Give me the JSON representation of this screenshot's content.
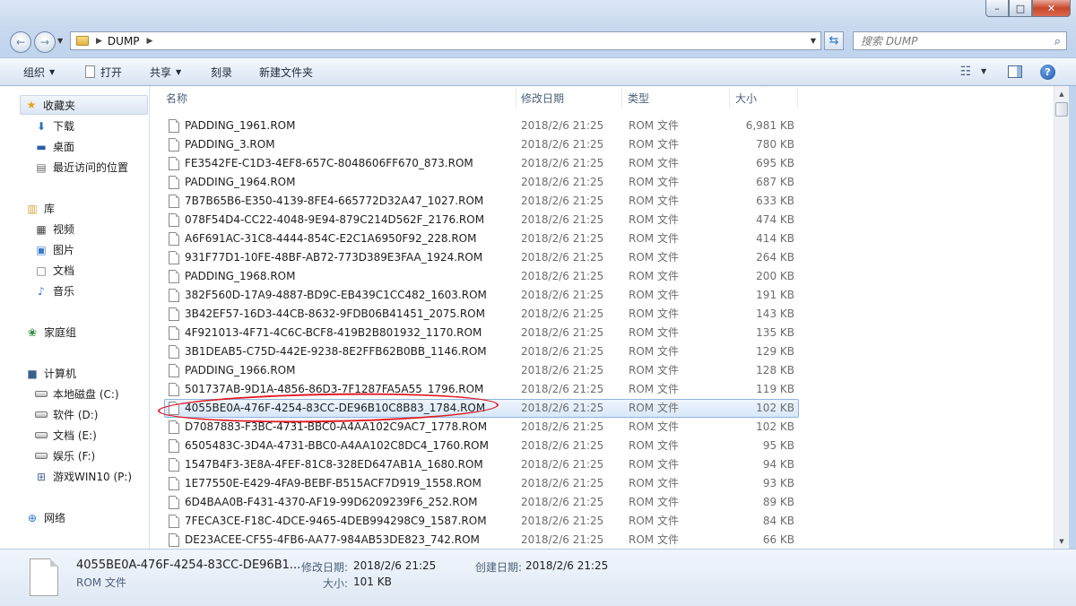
{
  "address": {
    "path": "DUMP"
  },
  "search": {
    "placeholder": "搜索 DUMP"
  },
  "toolbar": {
    "organize": "组织",
    "open": "打开",
    "share": "共享",
    "burn": "刻录",
    "new_folder": "新建文件夹"
  },
  "nav": {
    "favorites": "收藏夹",
    "downloads": "下载",
    "desktop": "桌面",
    "recent": "最近访问的位置",
    "libraries": "库",
    "videos": "视频",
    "pictures": "图片",
    "documents": "文档",
    "music": "音乐",
    "homegroup": "家庭组",
    "computer": "计算机",
    "drives": [
      "本地磁盘 (C:)",
      "软件 (D:)",
      "文档 (E:)",
      "娱乐 (F:)",
      "游戏WIN10 (P:)"
    ],
    "network": "网络"
  },
  "columns": {
    "name": "名称",
    "date": "修改日期",
    "type": "类型",
    "size": "大小"
  },
  "files": [
    {
      "name": "PADDING_1961.ROM",
      "date": "2018/2/6 21:25",
      "type": "ROM 文件",
      "size": "6,981 KB"
    },
    {
      "name": "PADDING_3.ROM",
      "date": "2018/2/6 21:25",
      "type": "ROM 文件",
      "size": "780 KB"
    },
    {
      "name": "FE3542FE-C1D3-4EF8-657C-8048606FF670_873.ROM",
      "date": "2018/2/6 21:25",
      "type": "ROM 文件",
      "size": "695 KB"
    },
    {
      "name": "PADDING_1964.ROM",
      "date": "2018/2/6 21:25",
      "type": "ROM 文件",
      "size": "687 KB"
    },
    {
      "name": "7B7B65B6-E350-4139-8FE4-665772D32A47_1027.ROM",
      "date": "2018/2/6 21:25",
      "type": "ROM 文件",
      "size": "633 KB"
    },
    {
      "name": "078F54D4-CC22-4048-9E94-879C214D562F_2176.ROM",
      "date": "2018/2/6 21:25",
      "type": "ROM 文件",
      "size": "474 KB"
    },
    {
      "name": "A6F691AC-31C8-4444-854C-E2C1A6950F92_228.ROM",
      "date": "2018/2/6 21:25",
      "type": "ROM 文件",
      "size": "414 KB"
    },
    {
      "name": "931F77D1-10FE-48BF-AB72-773D389E3FAA_1924.ROM",
      "date": "2018/2/6 21:25",
      "type": "ROM 文件",
      "size": "264 KB"
    },
    {
      "name": "PADDING_1968.ROM",
      "date": "2018/2/6 21:25",
      "type": "ROM 文件",
      "size": "200 KB"
    },
    {
      "name": "382F560D-17A9-4887-BD9C-EB439C1CC482_1603.ROM",
      "date": "2018/2/6 21:25",
      "type": "ROM 文件",
      "size": "191 KB"
    },
    {
      "name": "3B42EF57-16D3-44CB-8632-9FDB06B41451_2075.ROM",
      "date": "2018/2/6 21:25",
      "type": "ROM 文件",
      "size": "143 KB"
    },
    {
      "name": "4F921013-4F71-4C6C-BCF8-419B2B801932_1170.ROM",
      "date": "2018/2/6 21:25",
      "type": "ROM 文件",
      "size": "135 KB"
    },
    {
      "name": "3B1DEAB5-C75D-442E-9238-8E2FFB62B0BB_1146.ROM",
      "date": "2018/2/6 21:25",
      "type": "ROM 文件",
      "size": "129 KB"
    },
    {
      "name": "PADDING_1966.ROM",
      "date": "2018/2/6 21:25",
      "type": "ROM 文件",
      "size": "128 KB"
    },
    {
      "name": "501737AB-9D1A-4856-86D3-7F1287FA5A55_1796.ROM",
      "date": "2018/2/6 21:25",
      "type": "ROM 文件",
      "size": "119 KB"
    },
    {
      "name": "4055BE0A-476F-4254-83CC-DE96B10C8B83_1784.ROM",
      "date": "2018/2/6 21:25",
      "type": "ROM 文件",
      "size": "102 KB"
    },
    {
      "name": "D7087883-F3BC-4731-BBC0-A4AA102C9AC7_1778.ROM",
      "date": "2018/2/6 21:25",
      "type": "ROM 文件",
      "size": "102 KB"
    },
    {
      "name": "6505483C-3D4A-4731-BBC0-A4AA102C8DC4_1760.ROM",
      "date": "2018/2/6 21:25",
      "type": "ROM 文件",
      "size": "95 KB"
    },
    {
      "name": "1547B4F3-3E8A-4FEF-81C8-328ED647AB1A_1680.ROM",
      "date": "2018/2/6 21:25",
      "type": "ROM 文件",
      "size": "94 KB"
    },
    {
      "name": "1E77550E-E429-4FA9-BEBF-B515ACF7D919_1558.ROM",
      "date": "2018/2/6 21:25",
      "type": "ROM 文件",
      "size": "93 KB"
    },
    {
      "name": "6D4BAA0B-F431-4370-AF19-99D6209239F6_252.ROM",
      "date": "2018/2/6 21:25",
      "type": "ROM 文件",
      "size": "89 KB"
    },
    {
      "name": "7FECA3CE-F18C-4DCE-9465-4DEB994298C9_1587.ROM",
      "date": "2018/2/6 21:25",
      "type": "ROM 文件",
      "size": "84 KB"
    },
    {
      "name": "DE23ACEE-CF55-4FB6-AA77-984AB53DE823_742.ROM",
      "date": "2018/2/6 21:25",
      "type": "ROM 文件",
      "size": "66 KB"
    }
  ],
  "selected_index": 15,
  "details": {
    "name": "4055BE0A-476F-4254-83CC-DE96B1...",
    "type": "ROM 文件",
    "modified_label": "修改日期:",
    "modified_value": "2018/2/6 21:25",
    "created_label": "创建日期:",
    "created_value": "2018/2/6 21:25",
    "size_label": "大小:",
    "size_value": "101 KB"
  },
  "colors": {
    "annotation": "#e01b24",
    "selection": "#d7e7f9"
  }
}
